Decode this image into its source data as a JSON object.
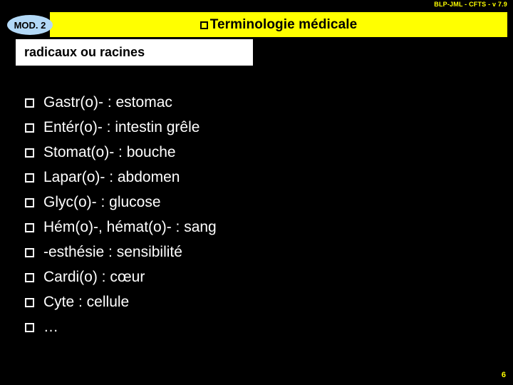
{
  "slide": {
    "credit": "BLP-JML - CFTS - v 7.9",
    "badge_label": "MOD. 2",
    "title": "Terminologie médicale",
    "subtitle": "radicaux ou racines",
    "page_number": "6",
    "colors": {
      "background": "#000000",
      "banner": "#ffff00",
      "badge": "#b3d9f7",
      "subtitle_box": "#ffffff",
      "body_text": "#ffffff",
      "accent_text": "#ffff00"
    },
    "bullet_icon": "hollow-square-bullet",
    "items": [
      {
        "label": "Gastr(o)- : estomac"
      },
      {
        "label": "Entér(o)- : intestin grêle"
      },
      {
        "label": "Stomat(o)- : bouche"
      },
      {
        "label": "Lapar(o)- : abdomen"
      },
      {
        "label": "Glyc(o)- : glucose"
      },
      {
        "label": "Hém(o)-, hémat(o)- : sang"
      },
      {
        "label": "-esthésie : sensibilité"
      },
      {
        "label": "Cardi(o) : cœur"
      },
      {
        "label": "Cyte : cellule"
      },
      {
        "label": "…"
      }
    ]
  }
}
